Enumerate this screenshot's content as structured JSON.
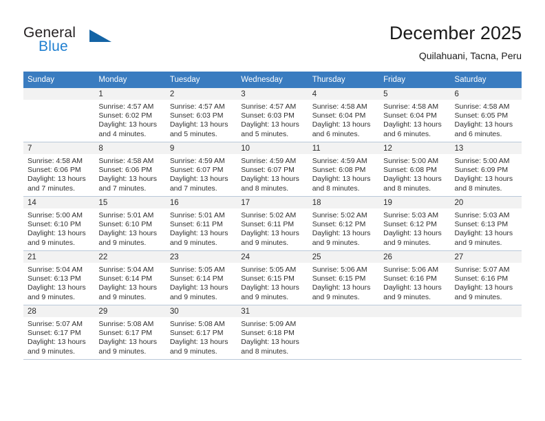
{
  "brand": {
    "name_top": "General",
    "name_bottom": "Blue",
    "triangle_color": "#1464a5",
    "blue_color": "#1f7fd0"
  },
  "header": {
    "title": "December 2025",
    "subtitle": "Quilahuani, Tacna, Peru"
  },
  "theme": {
    "header_row_bg": "#3a7cc0",
    "header_row_text": "#ffffff",
    "daynum_bg": "#f2f2f2",
    "grid_line": "#b9c8d9"
  },
  "weekday_headers": [
    "Sunday",
    "Monday",
    "Tuesday",
    "Wednesday",
    "Thursday",
    "Friday",
    "Saturday"
  ],
  "weeks": [
    [
      {
        "day": "",
        "sunrise": "",
        "sunset": "",
        "daylight_line1": "",
        "daylight_line2": ""
      },
      {
        "day": "1",
        "sunrise": "Sunrise: 4:57 AM",
        "sunset": "Sunset: 6:02 PM",
        "daylight_line1": "Daylight: 13 hours",
        "daylight_line2": "and 4 minutes."
      },
      {
        "day": "2",
        "sunrise": "Sunrise: 4:57 AM",
        "sunset": "Sunset: 6:03 PM",
        "daylight_line1": "Daylight: 13 hours",
        "daylight_line2": "and 5 minutes."
      },
      {
        "day": "3",
        "sunrise": "Sunrise: 4:57 AM",
        "sunset": "Sunset: 6:03 PM",
        "daylight_line1": "Daylight: 13 hours",
        "daylight_line2": "and 5 minutes."
      },
      {
        "day": "4",
        "sunrise": "Sunrise: 4:58 AM",
        "sunset": "Sunset: 6:04 PM",
        "daylight_line1": "Daylight: 13 hours",
        "daylight_line2": "and 6 minutes."
      },
      {
        "day": "5",
        "sunrise": "Sunrise: 4:58 AM",
        "sunset": "Sunset: 6:04 PM",
        "daylight_line1": "Daylight: 13 hours",
        "daylight_line2": "and 6 minutes."
      },
      {
        "day": "6",
        "sunrise": "Sunrise: 4:58 AM",
        "sunset": "Sunset: 6:05 PM",
        "daylight_line1": "Daylight: 13 hours",
        "daylight_line2": "and 6 minutes."
      }
    ],
    [
      {
        "day": "7",
        "sunrise": "Sunrise: 4:58 AM",
        "sunset": "Sunset: 6:06 PM",
        "daylight_line1": "Daylight: 13 hours",
        "daylight_line2": "and 7 minutes."
      },
      {
        "day": "8",
        "sunrise": "Sunrise: 4:58 AM",
        "sunset": "Sunset: 6:06 PM",
        "daylight_line1": "Daylight: 13 hours",
        "daylight_line2": "and 7 minutes."
      },
      {
        "day": "9",
        "sunrise": "Sunrise: 4:59 AM",
        "sunset": "Sunset: 6:07 PM",
        "daylight_line1": "Daylight: 13 hours",
        "daylight_line2": "and 7 minutes."
      },
      {
        "day": "10",
        "sunrise": "Sunrise: 4:59 AM",
        "sunset": "Sunset: 6:07 PM",
        "daylight_line1": "Daylight: 13 hours",
        "daylight_line2": "and 8 minutes."
      },
      {
        "day": "11",
        "sunrise": "Sunrise: 4:59 AM",
        "sunset": "Sunset: 6:08 PM",
        "daylight_line1": "Daylight: 13 hours",
        "daylight_line2": "and 8 minutes."
      },
      {
        "day": "12",
        "sunrise": "Sunrise: 5:00 AM",
        "sunset": "Sunset: 6:08 PM",
        "daylight_line1": "Daylight: 13 hours",
        "daylight_line2": "and 8 minutes."
      },
      {
        "day": "13",
        "sunrise": "Sunrise: 5:00 AM",
        "sunset": "Sunset: 6:09 PM",
        "daylight_line1": "Daylight: 13 hours",
        "daylight_line2": "and 8 minutes."
      }
    ],
    [
      {
        "day": "14",
        "sunrise": "Sunrise: 5:00 AM",
        "sunset": "Sunset: 6:10 PM",
        "daylight_line1": "Daylight: 13 hours",
        "daylight_line2": "and 9 minutes."
      },
      {
        "day": "15",
        "sunrise": "Sunrise: 5:01 AM",
        "sunset": "Sunset: 6:10 PM",
        "daylight_line1": "Daylight: 13 hours",
        "daylight_line2": "and 9 minutes."
      },
      {
        "day": "16",
        "sunrise": "Sunrise: 5:01 AM",
        "sunset": "Sunset: 6:11 PM",
        "daylight_line1": "Daylight: 13 hours",
        "daylight_line2": "and 9 minutes."
      },
      {
        "day": "17",
        "sunrise": "Sunrise: 5:02 AM",
        "sunset": "Sunset: 6:11 PM",
        "daylight_line1": "Daylight: 13 hours",
        "daylight_line2": "and 9 minutes."
      },
      {
        "day": "18",
        "sunrise": "Sunrise: 5:02 AM",
        "sunset": "Sunset: 6:12 PM",
        "daylight_line1": "Daylight: 13 hours",
        "daylight_line2": "and 9 minutes."
      },
      {
        "day": "19",
        "sunrise": "Sunrise: 5:03 AM",
        "sunset": "Sunset: 6:12 PM",
        "daylight_line1": "Daylight: 13 hours",
        "daylight_line2": "and 9 minutes."
      },
      {
        "day": "20",
        "sunrise": "Sunrise: 5:03 AM",
        "sunset": "Sunset: 6:13 PM",
        "daylight_line1": "Daylight: 13 hours",
        "daylight_line2": "and 9 minutes."
      }
    ],
    [
      {
        "day": "21",
        "sunrise": "Sunrise: 5:04 AM",
        "sunset": "Sunset: 6:13 PM",
        "daylight_line1": "Daylight: 13 hours",
        "daylight_line2": "and 9 minutes."
      },
      {
        "day": "22",
        "sunrise": "Sunrise: 5:04 AM",
        "sunset": "Sunset: 6:14 PM",
        "daylight_line1": "Daylight: 13 hours",
        "daylight_line2": "and 9 minutes."
      },
      {
        "day": "23",
        "sunrise": "Sunrise: 5:05 AM",
        "sunset": "Sunset: 6:14 PM",
        "daylight_line1": "Daylight: 13 hours",
        "daylight_line2": "and 9 minutes."
      },
      {
        "day": "24",
        "sunrise": "Sunrise: 5:05 AM",
        "sunset": "Sunset: 6:15 PM",
        "daylight_line1": "Daylight: 13 hours",
        "daylight_line2": "and 9 minutes."
      },
      {
        "day": "25",
        "sunrise": "Sunrise: 5:06 AM",
        "sunset": "Sunset: 6:15 PM",
        "daylight_line1": "Daylight: 13 hours",
        "daylight_line2": "and 9 minutes."
      },
      {
        "day": "26",
        "sunrise": "Sunrise: 5:06 AM",
        "sunset": "Sunset: 6:16 PM",
        "daylight_line1": "Daylight: 13 hours",
        "daylight_line2": "and 9 minutes."
      },
      {
        "day": "27",
        "sunrise": "Sunrise: 5:07 AM",
        "sunset": "Sunset: 6:16 PM",
        "daylight_line1": "Daylight: 13 hours",
        "daylight_line2": "and 9 minutes."
      }
    ],
    [
      {
        "day": "28",
        "sunrise": "Sunrise: 5:07 AM",
        "sunset": "Sunset: 6:17 PM",
        "daylight_line1": "Daylight: 13 hours",
        "daylight_line2": "and 9 minutes."
      },
      {
        "day": "29",
        "sunrise": "Sunrise: 5:08 AM",
        "sunset": "Sunset: 6:17 PM",
        "daylight_line1": "Daylight: 13 hours",
        "daylight_line2": "and 9 minutes."
      },
      {
        "day": "30",
        "sunrise": "Sunrise: 5:08 AM",
        "sunset": "Sunset: 6:17 PM",
        "daylight_line1": "Daylight: 13 hours",
        "daylight_line2": "and 9 minutes."
      },
      {
        "day": "31",
        "sunrise": "Sunrise: 5:09 AM",
        "sunset": "Sunset: 6:18 PM",
        "daylight_line1": "Daylight: 13 hours",
        "daylight_line2": "and 8 minutes."
      },
      {
        "day": "",
        "sunrise": "",
        "sunset": "",
        "daylight_line1": "",
        "daylight_line2": ""
      },
      {
        "day": "",
        "sunrise": "",
        "sunset": "",
        "daylight_line1": "",
        "daylight_line2": ""
      },
      {
        "day": "",
        "sunrise": "",
        "sunset": "",
        "daylight_line1": "",
        "daylight_line2": ""
      }
    ]
  ]
}
